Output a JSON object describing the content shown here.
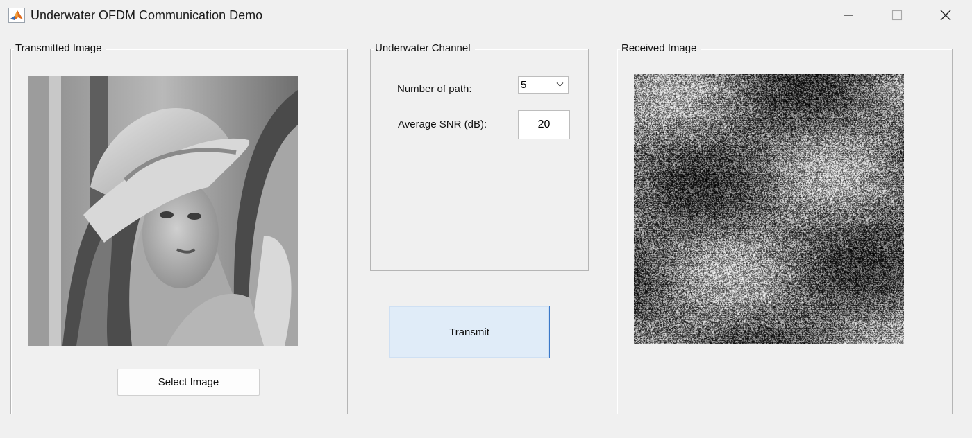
{
  "window": {
    "title": "Underwater OFDM Communication Demo",
    "icon": "matlab-icon",
    "controls": [
      "minimize-icon",
      "maximize-icon",
      "close-icon"
    ]
  },
  "transmitted_panel": {
    "title": "Transmitted Image",
    "image": "grayscale portrait of a woman wearing a wide-brimmed hat with a feather",
    "select_button": "Select Image"
  },
  "channel_panel": {
    "title": "Underwater Channel",
    "paths_label": "Number of path:",
    "paths_value": "5",
    "snr_label": "Average SNR (dB):",
    "snr_value": "20"
  },
  "transmit_button": "Transmit",
  "received_panel": {
    "title": "Received Image",
    "image": "noisy grayscale received image, heavily corrupted by channel noise"
  },
  "colors": {
    "background": "#f0f0f0",
    "transmit_button_fill": "#e0ecf8",
    "transmit_button_border": "#3a78c9"
  }
}
